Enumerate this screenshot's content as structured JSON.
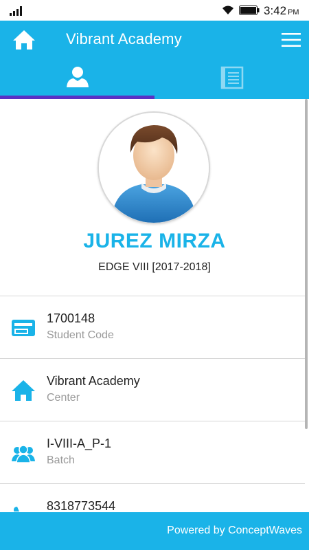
{
  "status_bar": {
    "time": "3:42",
    "ampm": "PM"
  },
  "app_bar": {
    "title": "Vibrant Academy"
  },
  "tabs": [
    {
      "name": "profile",
      "icon": "person-icon"
    },
    {
      "name": "documents",
      "icon": "document-icon"
    }
  ],
  "profile": {
    "name": "JUREZ MIRZA",
    "course": "EDGE VIII [2017-2018]"
  },
  "info": [
    {
      "icon": "id-card-icon",
      "value": "1700148",
      "label": "Student Code"
    },
    {
      "icon": "home-icon",
      "value": "Vibrant Academy",
      "label": "Center"
    },
    {
      "icon": "group-icon",
      "value": "I-VIII-A_P-1",
      "label": "Batch"
    },
    {
      "icon": "phone-icon",
      "value": "8318773544",
      "label": ""
    }
  ],
  "footer": {
    "text": "Powered by ConceptWaves"
  },
  "colors": {
    "primary": "#1ab3e8",
    "tab_indicator": "#5a30c4",
    "divider": "#d6d6d6"
  }
}
